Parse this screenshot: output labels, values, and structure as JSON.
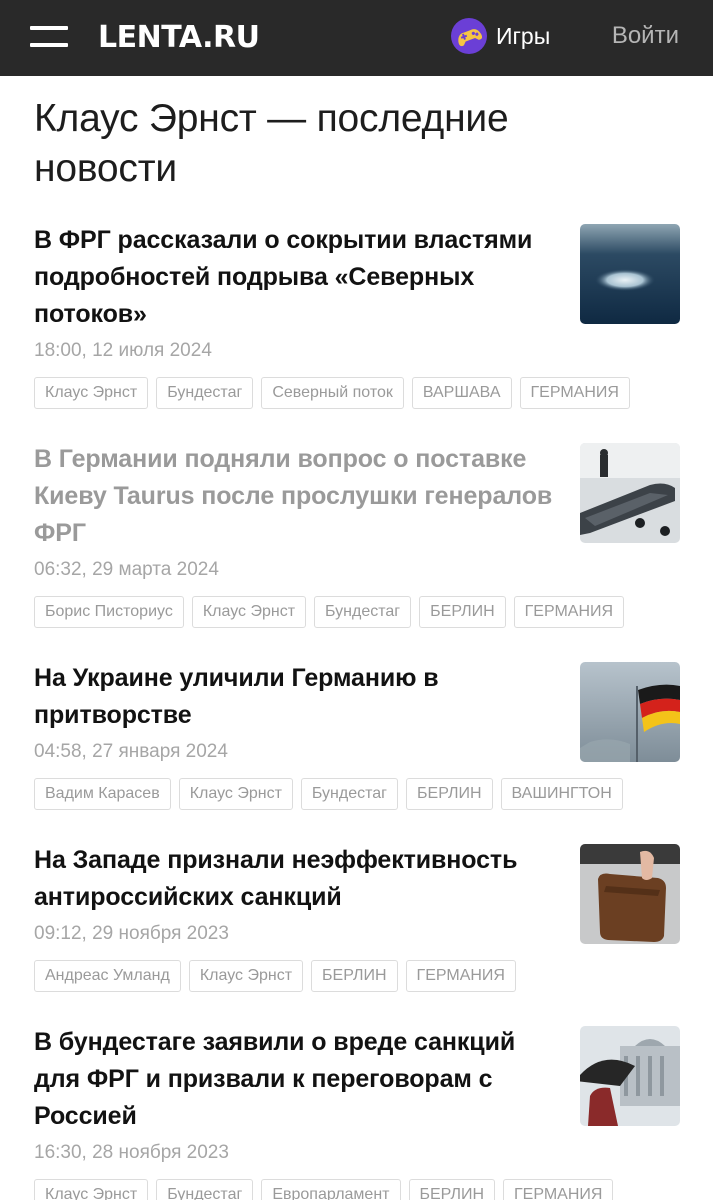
{
  "header": {
    "logo": "LENTA.RU",
    "games_label": "Игры",
    "login_label": "Войти"
  },
  "page": {
    "title": "Клаус Эрнст — последние новости"
  },
  "news": [
    {
      "title": "В ФРГ рассказали о сокрытии властями подробностей подрыва «Северных потоков»",
      "date": "18:00, 12 июля 2024",
      "tags": [
        "Клаус Эрнст",
        "Бундестаг",
        "Северный поток",
        "ВАРШАВА",
        "ГЕРМАНИЯ"
      ],
      "image_icon": "sea-gas-leak-photo"
    },
    {
      "title": "В Германии подняли вопрос о поставке Киеву Taurus после прослушки генералов ФРГ",
      "date": "06:32, 29 марта 2024",
      "tags": [
        "Борис Писториус",
        "Клаус Эрнст",
        "Бундестаг",
        "БЕРЛИН",
        "ГЕРМАНИЯ"
      ],
      "image_icon": "taurus-missile-photo"
    },
    {
      "title": "На Украине уличили Германию в притворстве",
      "date": "04:58, 27 января 2024",
      "tags": [
        "Вадим Карасев",
        "Клаус Эрнст",
        "Бундестаг",
        "БЕРЛИН",
        "ВАШИНГТОН"
      ],
      "image_icon": "german-flag-photo"
    },
    {
      "title": "На Западе признали неэффективность антироссийских санкций",
      "date": "09:12, 29 ноября 2023",
      "tags": [
        "Андреас Умланд",
        "Клаус Эрнст",
        "БЕРЛИН",
        "ГЕРМАНИЯ"
      ],
      "image_icon": "briefcase-photo"
    },
    {
      "title": "В бундестаге заявили о вреде санкций для ФРГ и призвали к переговорам с Россией",
      "date": "16:30, 28 ноября 2023",
      "tags": [
        "Клаус Эрнст",
        "Бундестаг",
        "Европарламент",
        "БЕРЛИН",
        "ГЕРМАНИЯ"
      ],
      "image_icon": "umbrella-reichstag-photo"
    }
  ]
}
